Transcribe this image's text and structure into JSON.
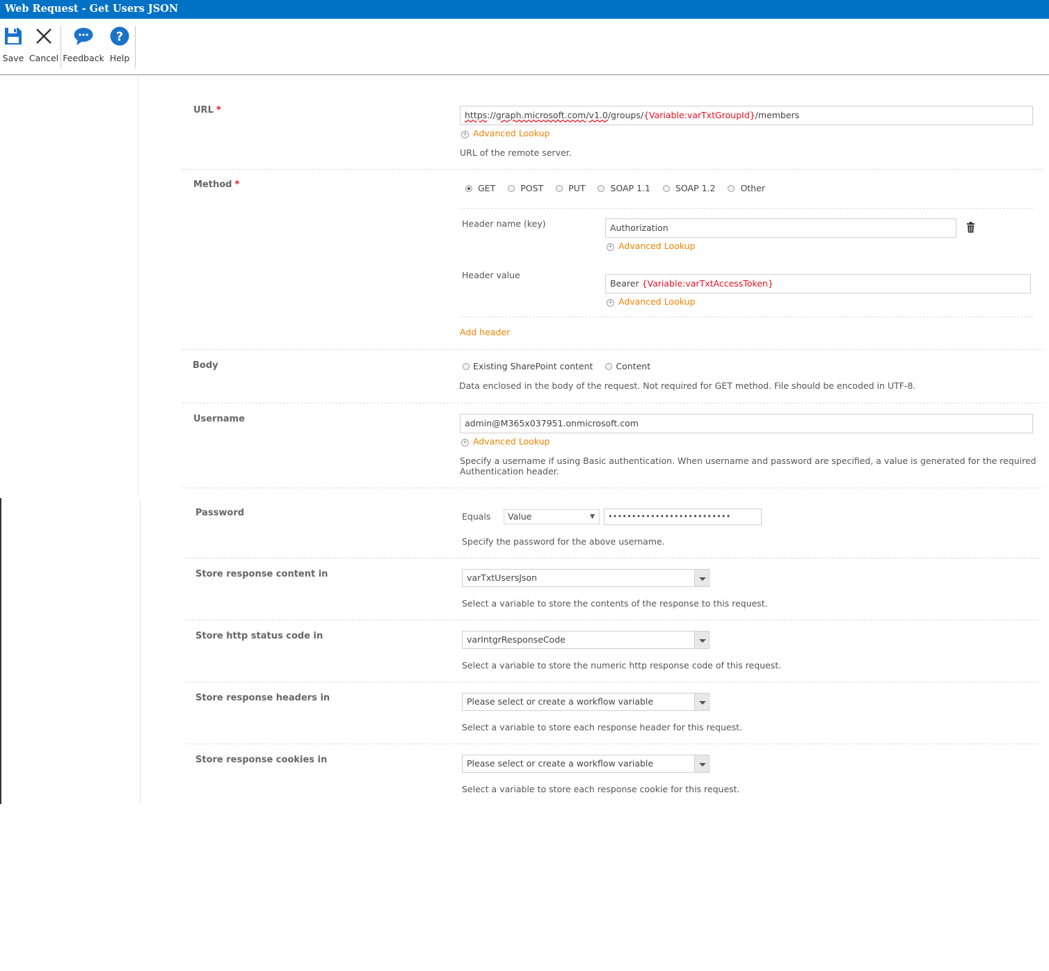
{
  "window": {
    "title": "Web Request - Get Users JSON"
  },
  "toolbar": {
    "save": "Save",
    "cancel": "Cancel",
    "feedback": "Feedback",
    "help": "Help"
  },
  "url": {
    "label": "URL",
    "required_mark": "*",
    "value_parts": [
      "https",
      "://",
      "graph.microsoft.com",
      "/",
      "v1.0",
      "/groups/",
      "{Variable:varTxtGroupId}",
      "/members"
    ],
    "lookup": "Advanced Lookup",
    "description": "URL of the remote server."
  },
  "method": {
    "label": "Method",
    "required_mark": "*",
    "options": [
      "GET",
      "POST",
      "PUT",
      "SOAP 1.1",
      "SOAP 1.2",
      "Other"
    ],
    "selected": "GET"
  },
  "headers": {
    "name_label": "Header name (key)",
    "name_value": "Authorization",
    "value_label": "Header value",
    "value_prefix": "Bearer ",
    "value_variable": "{Variable:varTxtAccessToken}",
    "lookup": "Advanced Lookup",
    "add_header": "Add header"
  },
  "body": {
    "label": "Body",
    "options": [
      "Existing SharePoint content",
      "Content"
    ],
    "description": "Data enclosed in the body of the request. Not required for GET method. File should be encoded in UTF-8."
  },
  "username": {
    "label": "Username",
    "value": "admin@M365x037951.onmicrosoft.com",
    "lookup": "Advanced Lookup",
    "description_line1": "Specify a username if using Basic authentication. When username and password are specified, a value is generated for the required",
    "description_line2": "Authentication header."
  },
  "password": {
    "label": "Password",
    "equals": "Equals",
    "type_value": "Value",
    "masked": "••••••••••••••••••••••••••",
    "description": "Specify the password for the above username."
  },
  "store_content": {
    "label": "Store response content in",
    "value": "varTxtUsersJson",
    "description": "Select a variable to store the contents of the response to this request."
  },
  "store_status": {
    "label": "Store http status code in",
    "value": "varIntgrResponseCode",
    "description": "Select a variable to store the numeric http response code of this request."
  },
  "store_headers": {
    "label": "Store response headers in",
    "placeholder": "Please select or create a workflow variable",
    "description": "Select a variable to store each response header for this request."
  },
  "store_cookies": {
    "label": "Store response cookies in",
    "placeholder": "Please select or create a workflow variable",
    "description": "Select a variable to store each response cookie for this request."
  },
  "colors": {
    "titlebar": "#0072c6",
    "accent": "#f08200",
    "variable": "#e81123",
    "icon": "#1a73c8"
  }
}
